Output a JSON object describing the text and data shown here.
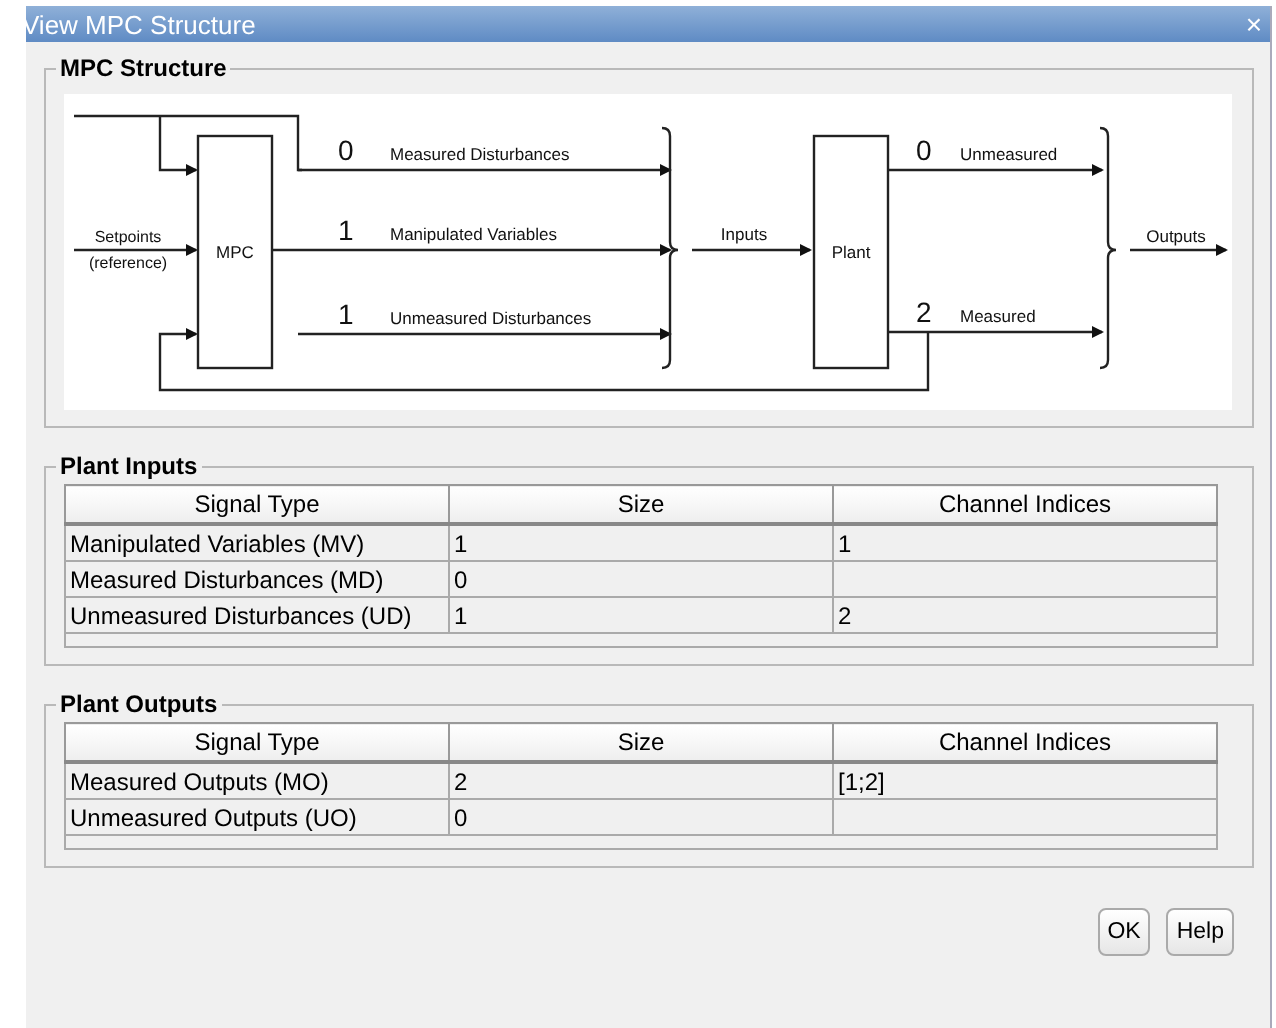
{
  "window": {
    "title": "View MPC Structure",
    "close": "×"
  },
  "structure": {
    "title": "MPC Structure",
    "setpoints_label": [
      "Setpoints",
      "(reference)"
    ],
    "controller": "MPC",
    "controller_outputs": [
      {
        "count": "0",
        "label": "Measured Disturbances"
      },
      {
        "count": "1",
        "label": "Manipulated Variables"
      },
      {
        "count": "1",
        "label": "Unmeasured Disturbances"
      }
    ],
    "inputs_label": "Inputs",
    "plant": "Plant",
    "plant_outputs": [
      {
        "count": "0",
        "label": "Unmeasured"
      },
      {
        "count": "2",
        "label": "Measured"
      }
    ],
    "outputs_label": "Outputs"
  },
  "plant_inputs": {
    "title": "Plant Inputs",
    "columns": [
      "Signal Type",
      "Size",
      "Channel Indices"
    ],
    "rows": [
      {
        "signal_type": "Manipulated Variables (MV)",
        "size": "1",
        "channel_indices": "1"
      },
      {
        "signal_type": "Measured Disturbances (MD)",
        "size": "0"
      },
      {
        "signal_type": "Unmeasured Disturbances (UD)",
        "size": "1",
        "channel_indices": "2"
      }
    ]
  },
  "plant_outputs": {
    "title": "Plant Outputs",
    "columns": [
      "Signal Type",
      "Size",
      "Channel Indices"
    ],
    "rows": [
      {
        "signal_type": "Measured Outputs (MO)",
        "size": "2",
        "channel_indices": "[1;2]"
      },
      {
        "signal_type": "Unmeasured Outputs (UO)",
        "size": "0"
      }
    ]
  },
  "buttons": [
    "OK",
    "Help"
  ]
}
